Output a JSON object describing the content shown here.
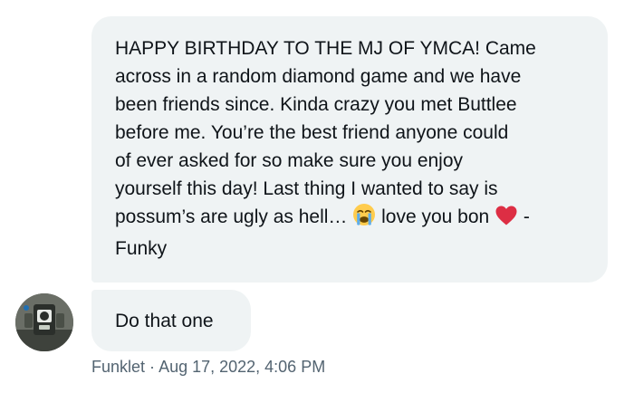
{
  "messages": [
    {
      "text_lines": [
        "HAPPY BIRTHDAY TO THE MJ OF YMCA! Came",
        "across in a random diamond game and we have",
        "been friends since. Kinda crazy you met Buttlee",
        "before me. You’re the best friend anyone could",
        "of ever asked for so make sure you enjoy",
        "yourself this day! Last thing I wanted to say is",
        "possum’s are ugly as hell…",
        "love you bon",
        "-",
        "Funky"
      ],
      "emojis": [
        "crying-face-emoji",
        "red-heart-emoji"
      ]
    },
    {
      "text": "Do that one"
    }
  ],
  "meta": {
    "sender": "Funklet",
    "separator": "·",
    "timestamp": "Aug 17, 2022, 4:06 PM"
  },
  "colors": {
    "bubble_bg": "#eff3f4",
    "text": "#0f1419",
    "meta_text": "#536471",
    "heart": "#e0245e"
  }
}
